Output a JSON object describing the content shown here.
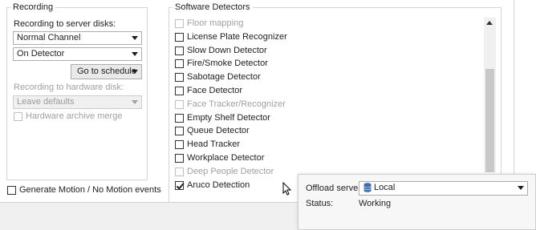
{
  "recording": {
    "title": "Recording",
    "server_disks_label": "Recording to server disks:",
    "channel_value": "Normal Channel",
    "mode_value": "On Detector",
    "schedule_button": "Go to schedule",
    "hardware_disk_label": "Recording to hardware disk:",
    "hardware_value": "Leave defaults",
    "archive_merge_label": "Hardware archive merge"
  },
  "motion": {
    "label": "Generate Motion / No Motion events",
    "checked": false
  },
  "detectors": {
    "title": "Software Detectors",
    "items": [
      {
        "label": "Floor mapping",
        "checked": false,
        "enabled": false
      },
      {
        "label": "License Plate Recognizer",
        "checked": false,
        "enabled": true
      },
      {
        "label": "Slow Down Detector",
        "checked": false,
        "enabled": true
      },
      {
        "label": "Fire/Smoke Detector",
        "checked": false,
        "enabled": true
      },
      {
        "label": "Sabotage Detector",
        "checked": false,
        "enabled": true
      },
      {
        "label": "Face Detector",
        "checked": false,
        "enabled": true
      },
      {
        "label": "Face Tracker/Recognizer",
        "checked": false,
        "enabled": false
      },
      {
        "label": "Empty Shelf Detector",
        "checked": false,
        "enabled": true
      },
      {
        "label": "Queue Detector",
        "checked": false,
        "enabled": true
      },
      {
        "label": "Head Tracker",
        "checked": false,
        "enabled": true
      },
      {
        "label": "Workplace Detector",
        "checked": false,
        "enabled": true
      },
      {
        "label": "Deep People Detector",
        "checked": false,
        "enabled": false
      },
      {
        "label": "Aruco Detection",
        "checked": true,
        "enabled": true
      }
    ]
  },
  "offload": {
    "server_label": "Offload server:",
    "server_value": "Local",
    "server_icon": "database-icon",
    "status_label": "Status:",
    "status_value": "Working"
  }
}
